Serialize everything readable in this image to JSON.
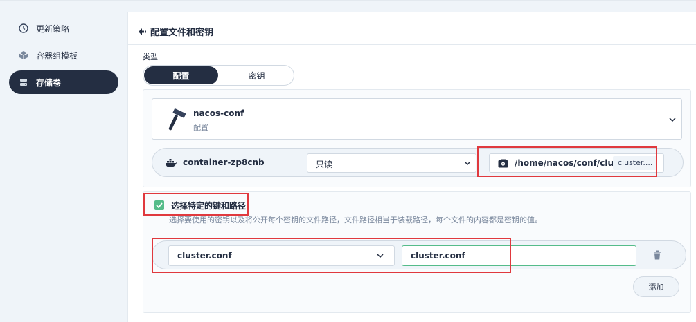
{
  "sidebar": {
    "items": [
      {
        "label": "更新策略",
        "icon": "clock-icon",
        "active": false
      },
      {
        "label": "容器组模板",
        "icon": "cube-icon",
        "active": false
      },
      {
        "label": "存储卷",
        "icon": "storage-icon",
        "active": true
      }
    ]
  },
  "header": {
    "title": "配置文件和密钥"
  },
  "type_selector": {
    "label": "类型",
    "options": [
      "配置",
      "密钥"
    ],
    "selected": "配置"
  },
  "resource": {
    "name": "nacos-conf",
    "type": "配置"
  },
  "mount": {
    "container": "container-zp8cnb",
    "access_mode": "只读",
    "mount_path": "/home/nacos/conf/cluster.conf",
    "sub_path_tag": "cluster...."
  },
  "specific_keys": {
    "checked": true,
    "label": "选择特定的键和路径",
    "description": "选择要使用的密钥以及将公开每个密钥的文件路径，文件路径相当于装载路径，每个文件的内容都是密钥的值。",
    "key": "cluster.conf",
    "path": "cluster.conf",
    "add_label": "添加"
  },
  "colors": {
    "accent": "#55bc8a",
    "dark": "#242e42",
    "highlight": "#e0393e"
  }
}
